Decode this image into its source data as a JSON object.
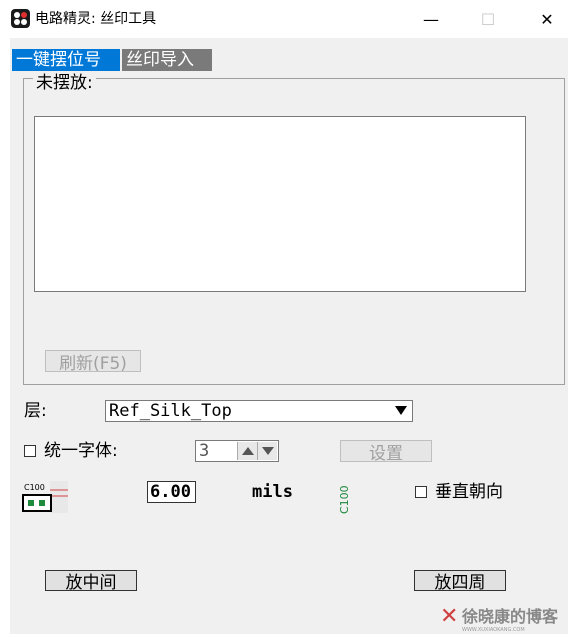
{
  "window": {
    "title": "电路精灵: 丝印工具",
    "minimize": "—",
    "maximize": "☐",
    "close": "✕"
  },
  "tabs": [
    {
      "label": "一键摆位号",
      "active": true
    },
    {
      "label": "丝印导入",
      "active": false
    }
  ],
  "unplaced": {
    "group_label": "未摆放:",
    "items": [],
    "refresh_label": "刷新(F5)"
  },
  "layer": {
    "label": "层:",
    "selected": "Ref_Silk_Top"
  },
  "font": {
    "unify_label": "统一字体:",
    "checked": false,
    "size_value": "3",
    "settings_label": "设置"
  },
  "offset": {
    "icon_text": "C100",
    "value": "6.00",
    "unit": "mils",
    "preview_text": "C100",
    "vertical_label": "垂直朝向",
    "vertical_checked": false
  },
  "actions": {
    "center_label": "放中间",
    "around_label": "放四周"
  },
  "watermark": {
    "title": "徐晓康的博客",
    "subtitle": "WWW.XUXIAOKANG.COM"
  },
  "colors": {
    "accent": "#0078d7",
    "tab_inactive": "#7a7a7a",
    "icon_green": "#1e8a3c",
    "watermark_red": "#d04040"
  }
}
